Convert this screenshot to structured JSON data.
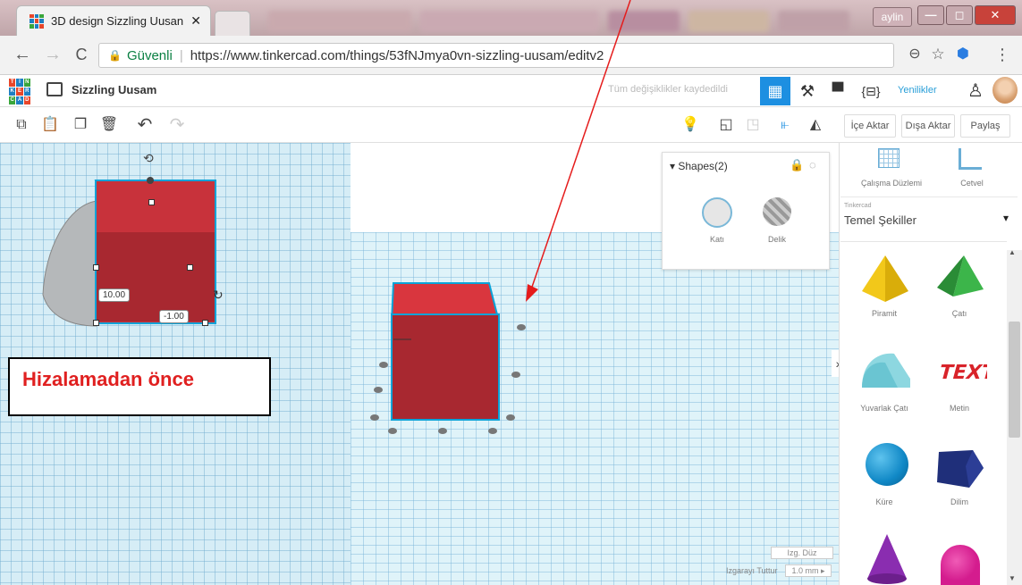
{
  "browser": {
    "tab_title": "3D design Sizzling Uusan",
    "tab_close": "✕",
    "user": "aylin",
    "win_min": "—",
    "win_max": "◻",
    "win_close": "✕",
    "back": "←",
    "forward": "→",
    "reload": "C",
    "security_label": "Güvenli",
    "url": "https://www.tinkercad.com/things/53fNJmya0vn-sizzling-uusam/editv2",
    "zoom_icon": "⊖",
    "star_icon": "☆",
    "menu_icon": "⋮"
  },
  "app": {
    "logo": [
      "T",
      "I",
      "N",
      "K",
      "E",
      "R",
      "C",
      "A",
      "D"
    ],
    "doc_name": "Sizzling Uusam",
    "saved_status": "Tüm değişiklikler kaydedildi",
    "news_label": "Yenilikler",
    "braces_label": "{⊟}"
  },
  "toolbar": {
    "import_label": "İçe Aktar",
    "export_label": "Dışa Aktar",
    "share_label": "Paylaş"
  },
  "shapes_panel": {
    "title": "Shapes(2)",
    "solid_label": "Katı",
    "hole_label": "Delik"
  },
  "viewport": {
    "dim_height": "10.00",
    "dim_offset": "-1.00",
    "annotation": "Hizalamadan önce",
    "grid_edit": "Izg. Düz",
    "snap_label": "Izgarayı Tuttur",
    "snap_value": "1.0 mm ▸",
    "expand_chevron": "›"
  },
  "sidebar": {
    "workplane_label": "Çalışma Düzlemi",
    "ruler_label": "Cetvel",
    "library_small": "Tinkercad",
    "library_name": "Temel Şekiller",
    "dropdown_arrow": "▾",
    "shapes": [
      "Piramit",
      "Çatı",
      "Yuvarlak Çatı",
      "Metin",
      "Küre",
      "Dilim"
    ]
  }
}
